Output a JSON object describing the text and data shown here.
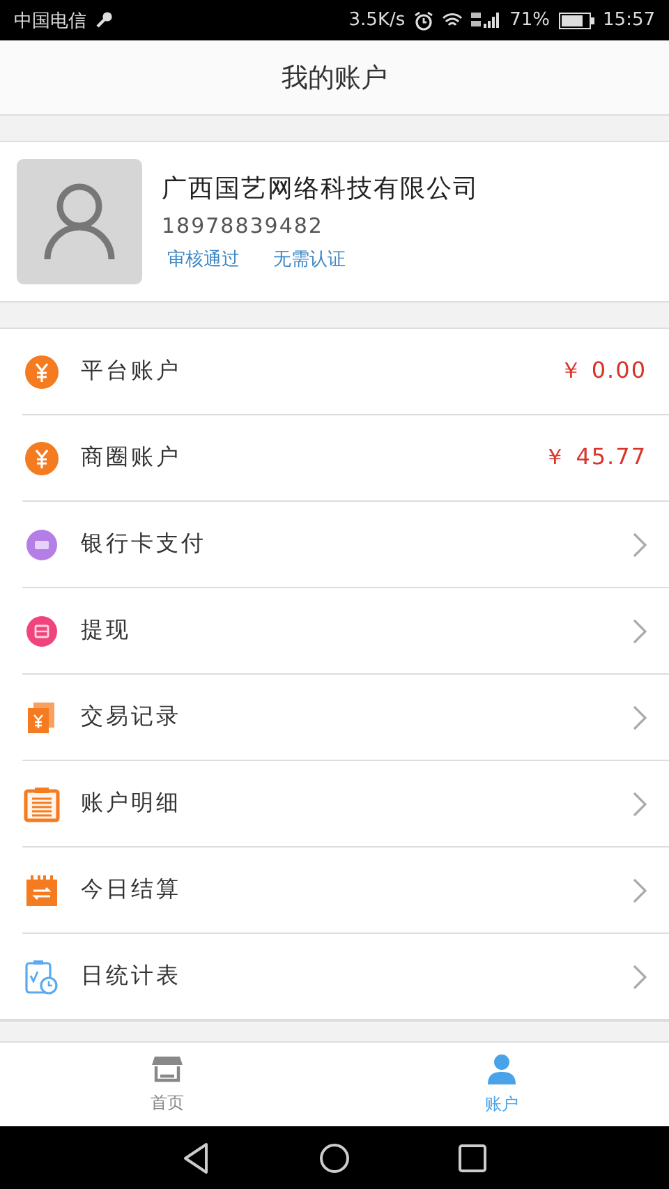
{
  "status_bar": {
    "carrier": "中国电信",
    "speed": "3.5K/s",
    "battery": "71%",
    "time": "15:57"
  },
  "header": {
    "title": "我的账户"
  },
  "profile": {
    "name": "广西国艺网络科技有限公司",
    "phone": "18978839482",
    "badges": [
      "审核通过",
      "无需认证"
    ]
  },
  "menu": [
    {
      "kind": "balance",
      "label": "平台账户",
      "amount": "￥ 0.00"
    },
    {
      "kind": "balance",
      "label": "商圈账户",
      "amount": "￥ 45.77"
    },
    {
      "kind": "link",
      "label": "银行卡支付"
    },
    {
      "kind": "link",
      "label": "提现"
    },
    {
      "kind": "link",
      "label": "交易记录"
    },
    {
      "kind": "link",
      "label": "账户明细"
    },
    {
      "kind": "link",
      "label": "今日结算"
    },
    {
      "kind": "link",
      "label": "日统计表"
    }
  ],
  "tabs": [
    {
      "label": "首页",
      "selected": false
    },
    {
      "label": "账户",
      "selected": true
    }
  ]
}
